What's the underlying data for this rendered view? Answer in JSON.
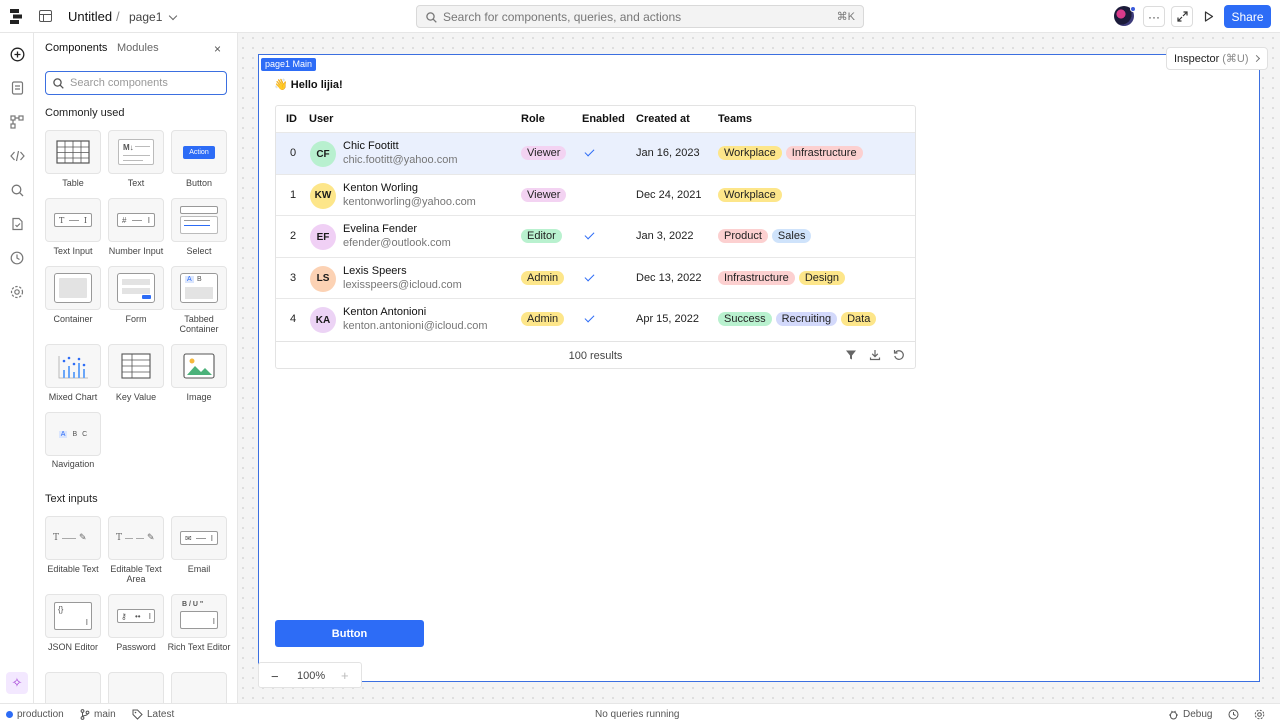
{
  "topbar": {
    "app_title": "Untitled",
    "separator": "/",
    "page_name": "page1",
    "search_placeholder": "Search for components, queries, and actions",
    "search_shortcut": "⌘K",
    "more_label": "···",
    "share_label": "Share"
  },
  "panel": {
    "tabs": [
      "Components",
      "Modules"
    ],
    "close_label": "×",
    "search_placeholder": "Search components",
    "sections": [
      {
        "title": "Commonly used",
        "items": [
          "Table",
          "Text",
          "Button",
          "Text Input",
          "Number Input",
          "Select",
          "Container",
          "Form",
          "Tabbed Container",
          "Mixed Chart",
          "Key Value",
          "Image",
          "Navigation"
        ]
      },
      {
        "title": "Text inputs",
        "items": [
          "Editable Text",
          "Editable Text Area",
          "Email",
          "JSON Editor",
          "Password",
          "Rich Text Editor"
        ]
      }
    ],
    "button_tile_text": "Action",
    "nav_tile_text": [
      "A",
      "B",
      "C"
    ],
    "tabbed_tile_text": [
      "A",
      "B"
    ],
    "text_tile_text": "M↓",
    "rich_tile_text": "B / U \""
  },
  "canvas": {
    "frame_tag": "page1 Main",
    "inspector_label": "Inspector",
    "inspector_shortcut": "(⌘U)",
    "greeting": "👋 Hello lijia!",
    "button_label": "Button",
    "zoom": {
      "minus": "−",
      "value": "100%",
      "plus": "+"
    }
  },
  "table": {
    "columns": [
      "ID",
      "User",
      "Role",
      "Enabled",
      "Created at",
      "Teams"
    ],
    "rows": [
      {
        "id": "0",
        "initials": "CF",
        "name": "Chic Footitt",
        "email": "chic.footitt@yahoo.com",
        "role": "Viewer",
        "enabled": true,
        "created": "Jan 16, 2023",
        "teams": [
          "Workplace",
          "Infrastructure"
        ],
        "avatar_color": "#b8f0cf"
      },
      {
        "id": "1",
        "initials": "KW",
        "name": "Kenton Worling",
        "email": "kentonworling@yahoo.com",
        "role": "Viewer",
        "enabled": false,
        "created": "Dec 24, 2021",
        "teams": [
          "Workplace"
        ],
        "avatar_color": "#fde68a"
      },
      {
        "id": "2",
        "initials": "EF",
        "name": "Evelina Fender",
        "email": "efender@outlook.com",
        "role": "Editor",
        "enabled": true,
        "created": "Jan 3, 2022",
        "teams": [
          "Product",
          "Sales"
        ],
        "avatar_color": "#f0d0f5"
      },
      {
        "id": "3",
        "initials": "LS",
        "name": "Lexis Speers",
        "email": "lexisspeers@icloud.com",
        "role": "Admin",
        "enabled": true,
        "created": "Dec 13, 2022",
        "teams": [
          "Infrastructure",
          "Design"
        ],
        "avatar_color": "#fcd2b4"
      },
      {
        "id": "4",
        "initials": "KA",
        "name": "Kenton Antonioni",
        "email": "kenton.antonioni@icloud.com",
        "role": "Admin",
        "enabled": true,
        "created": "Apr 15, 2022",
        "teams": [
          "Success",
          "Recruiting",
          "Data"
        ],
        "avatar_color": "#ecd3f5"
      }
    ],
    "results_label": "100 results",
    "role_colors": {
      "Viewer": "#f3d3f2",
      "Editor": "#b9f1cf",
      "Admin": "#fde68a"
    },
    "team_colors": {
      "Workplace": "#fde68a",
      "Infrastructure": "#fcd0d0",
      "Product": "#fcd0d0",
      "Sales": "#cfe3fb",
      "Design": "#fde68a",
      "Success": "#b9f1cf",
      "Recruiting": "#d3d9fb",
      "Data": "#fde68a"
    }
  },
  "status": {
    "environment": "production",
    "branch": "main",
    "version": "Latest",
    "queries": "No queries running",
    "debug": "Debug"
  },
  "colors": {
    "accent": "#2d6cf6",
    "selected_row": "#eaf0fd"
  }
}
